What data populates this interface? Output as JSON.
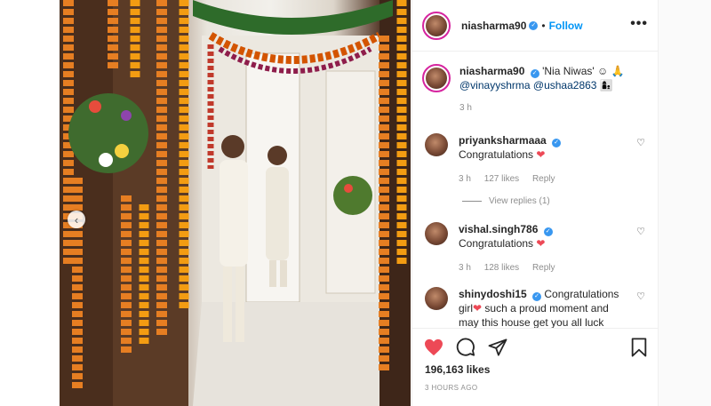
{
  "post": {
    "username": "niasharma90",
    "follow_label": "Follow",
    "more_label": "•••",
    "caption_text": "'Nia Niwas' ☺ 🙏",
    "caption_mention_1": "@vinayyshrma",
    "caption_mention_2": "@ushaa2863",
    "caption_emoji": "👩‍👦",
    "caption_time": "3 h",
    "likes": "196,163 likes",
    "posted_ago": "3 HOURS AGO"
  },
  "comments": [
    {
      "username": "priyanksharmaaa",
      "text": "Congratulations",
      "time": "3 h",
      "likes": "127 likes",
      "reply_label": "Reply"
    },
    {
      "username": "vishal.singh786",
      "text": "Congratulations",
      "time": "3 h",
      "likes": "128 likes",
      "reply_label": "Reply"
    },
    {
      "username": "shinydoshi15",
      "text_a": "Congratulations girl",
      "text_b": " such a proud moment and may this house get you all luck"
    }
  ],
  "view_replies": "View replies (1)",
  "icons": {
    "like": "heart-icon",
    "comment": "comment-icon",
    "share": "share-icon",
    "save": "bookmark-icon",
    "verified": "verified-badge-icon",
    "carousel_prev": "chevron-left-icon"
  },
  "colors": {
    "accent": "#0095f6",
    "like": "#ed4956",
    "verified": "#3897f0",
    "muted": "#8e8e8e"
  }
}
